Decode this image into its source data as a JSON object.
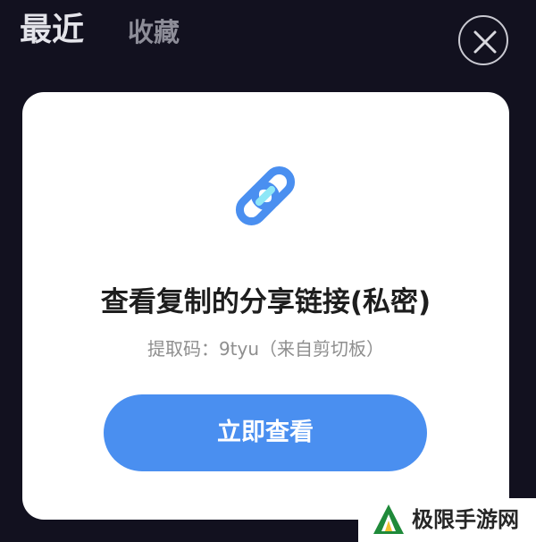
{
  "header": {
    "tabs": [
      {
        "label": "最近",
        "active": true
      },
      {
        "label": "收藏",
        "active": false
      }
    ]
  },
  "close_button": {
    "icon": "close-icon"
  },
  "dialog": {
    "icon": "link-icon",
    "title": "查看复制的分享链接(私密)",
    "subtitle": "提取码：9tyu（来自剪切板）",
    "button_label": "立即查看"
  },
  "watermark": {
    "text": "极限手游网",
    "logo_icon": "logo-icon"
  },
  "colors": {
    "background": "#12111f",
    "accent": "#4a8ff0",
    "link_icon_light": "#8ee7f7"
  }
}
